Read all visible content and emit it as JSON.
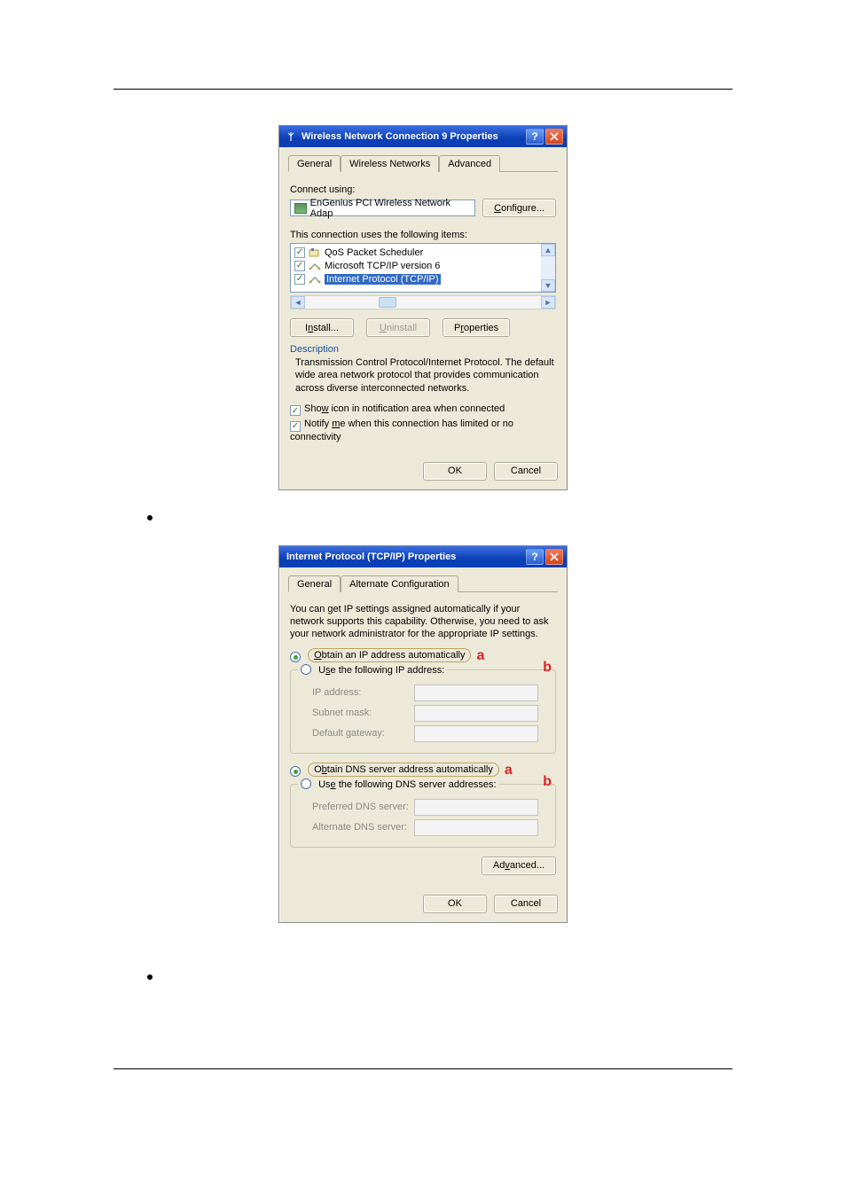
{
  "dlg1": {
    "title": "Wireless Network Connection 9 Properties",
    "tabs": {
      "general": "General",
      "wifi": "Wireless Networks",
      "adv": "Advanced"
    },
    "connect_using_label": "Connect using:",
    "adapter_name": "EnGenius PCI Wireless Network Adap",
    "configure_btn": "Configure...",
    "items_label": "This connection uses the following items:",
    "items": [
      {
        "label": "QoS Packet Scheduler",
        "checked": true
      },
      {
        "label": "Microsoft TCP/IP version 6",
        "checked": true
      },
      {
        "label": "Internet Protocol (TCP/IP)",
        "checked": true,
        "selected": true
      }
    ],
    "install_btn": "Install...",
    "uninstall_btn": "Uninstall",
    "properties_btn": "Properties",
    "desc_head": "Description",
    "desc_body": "Transmission Control Protocol/Internet Protocol. The default wide area network protocol that provides communication across diverse interconnected networks.",
    "chk1": "Show icon in notification area when connected",
    "chk2": "Notify me when this connection has limited or no connectivity",
    "ok": "OK",
    "cancel": "Cancel"
  },
  "dlg2": {
    "title": "Internet Protocol (TCP/IP) Properties",
    "tabs": {
      "general": "General",
      "alt": "Alternate Configuration"
    },
    "intro": "You can get IP settings assigned automatically if your network supports this capability. Otherwise, you need to ask your network administrator for the appropriate IP settings.",
    "opt_auto_ip": "Obtain an IP address automatically",
    "opt_use_ip": "Use the following IP address:",
    "lbl_ip": "IP address:",
    "lbl_mask": "Subnet mask:",
    "lbl_gw": "Default gateway:",
    "opt_auto_dns": "Obtain DNS server address automatically",
    "opt_use_dns": "Use the following DNS server addresses:",
    "lbl_pdns": "Preferred DNS server:",
    "lbl_adns": "Alternate DNS server:",
    "adv_btn": "Advanced...",
    "ok": "OK",
    "cancel": "Cancel",
    "annot_a": "a",
    "annot_b": "b"
  }
}
